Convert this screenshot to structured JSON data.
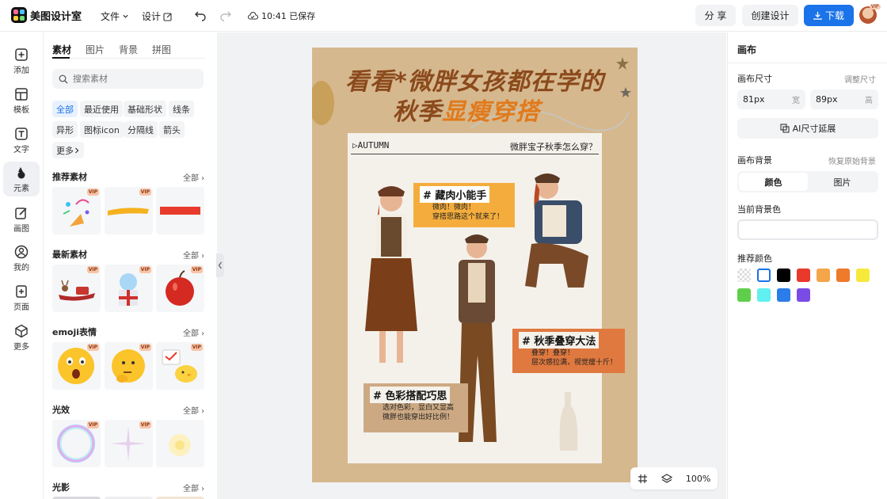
{
  "app": {
    "name": "美图设计室"
  },
  "topbar": {
    "menu_file": "文件",
    "menu_design": "设计",
    "save_status": "10:41 已保存",
    "share_label": "分 享",
    "create_label": "创建设计",
    "download_label": "下载",
    "avatar_badge": "VIP"
  },
  "rail": [
    {
      "label": "添加",
      "icon": "plus-square-icon"
    },
    {
      "label": "模板",
      "icon": "template-icon"
    },
    {
      "label": "文字",
      "icon": "text-icon"
    },
    {
      "label": "元素",
      "icon": "shapes-icon",
      "active": true
    },
    {
      "label": "画图",
      "icon": "pen-icon"
    },
    {
      "label": "我的",
      "icon": "user-icon"
    },
    {
      "label": "页面",
      "icon": "add-page-icon"
    },
    {
      "label": "更多",
      "icon": "cube-icon"
    }
  ],
  "panel": {
    "tabs": [
      "素材",
      "图片",
      "背景",
      "拼图"
    ],
    "search_placeholder": "搜索素材",
    "chips": [
      "全部",
      "最近使用",
      "基础形状",
      "线条",
      "异形",
      "图标icon",
      "分隔线",
      "箭头",
      "更多"
    ],
    "see_all": "全部",
    "sections": [
      {
        "title": "推荐素材"
      },
      {
        "title": "最新素材"
      },
      {
        "title": "emoji表情"
      },
      {
        "title": "光效"
      },
      {
        "title": "光影"
      }
    ],
    "vip_badge": "VIP"
  },
  "poster": {
    "title_line1": "看看*微胖女孩都在学的",
    "title_line2_a": "秋季",
    "title_line2_b": "显瘦穿搭",
    "autumn": "▷AUTUMN",
    "question": "微胖宝子秋季怎么穿？",
    "tag1": {
      "heading": "# 藏肉小能手",
      "lines": [
        "微肉！微肉！",
        "穿搭思路这个就来了！"
      ]
    },
    "tag2": {
      "heading": "# 秋季叠穿大法",
      "lines": [
        "叠穿！叠穿！",
        "层次感拉满，视觉瘦十斤！"
      ]
    },
    "tag3": {
      "heading": "# 色彩搭配巧思",
      "lines": [
        "选对色彩，显白又显高",
        "微胖也能穿出好比例！"
      ]
    }
  },
  "zoom": {
    "level": "100%"
  },
  "right": {
    "title": "画布",
    "size_label": "画布尺寸",
    "size_hint": "调整尺寸",
    "width_value": "81px",
    "width_unit": "宽",
    "height_value": "89px",
    "height_unit": "高",
    "ai_extend_label": "AI尺寸延展",
    "bg_label": "画布背景",
    "bg_hint": "恢复原始背景",
    "seg_color": "颜色",
    "seg_image": "图片",
    "current_bg_label": "当前背景色",
    "recommended_label": "推荐颜色",
    "swatches": [
      "transparent",
      "#ffffff",
      "#000000",
      "#e8392b",
      "#f5a54a",
      "#ee7a2b",
      "#f7e83c",
      "#5fcf4b",
      "#5ff0ef",
      "#2b7de9",
      "#7b4be5"
    ]
  }
}
